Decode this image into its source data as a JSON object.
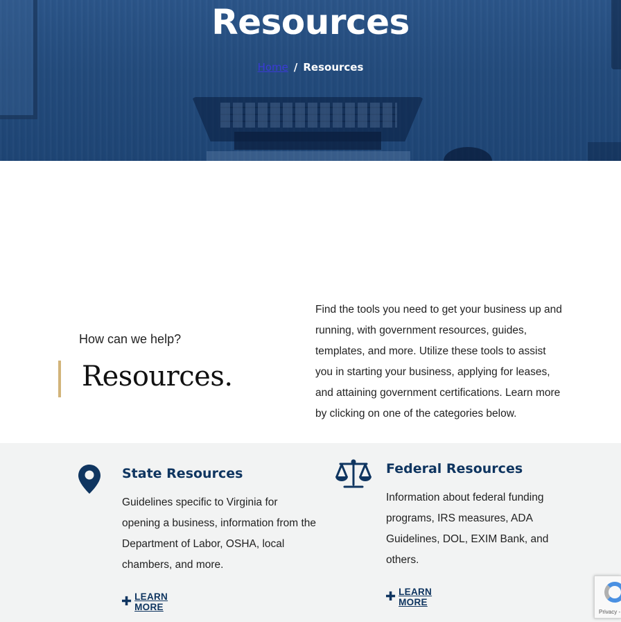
{
  "hero": {
    "title": "Resources",
    "breadcrumb": {
      "home": "Home",
      "separator": "/",
      "current": "Resources"
    }
  },
  "intro": {
    "eyebrow": "How can we help?",
    "title": "Resources.",
    "description": "Find the tools you need to get your business up and running, with government resources, guides, templates, and more.  Utilize these tools to assist you in starting your business, applying for leases, and attaining government certifications. Learn more by clicking on one of the categories below."
  },
  "cards": [
    {
      "icon": "map-pin-icon",
      "title": "State Resources",
      "description": "Guidelines specific to Virginia for opening a business, information from the Department of Labor, OSHA, local chambers, and more.",
      "link": "LEARN MORE"
    },
    {
      "icon": "scales-icon",
      "title": "Federal Resources",
      "description": "Information about federal funding programs, IRS measures, ADA Guidelines, DOL, EXIM Bank, and others.",
      "link": "LEARN MORE"
    }
  ],
  "recaptcha": {
    "text": "Privacy - Terms"
  },
  "colors": {
    "navy": "#0f3560",
    "accent": "#d2b47a",
    "hero": "#234b7c",
    "section_bg": "#f2f3f3"
  }
}
